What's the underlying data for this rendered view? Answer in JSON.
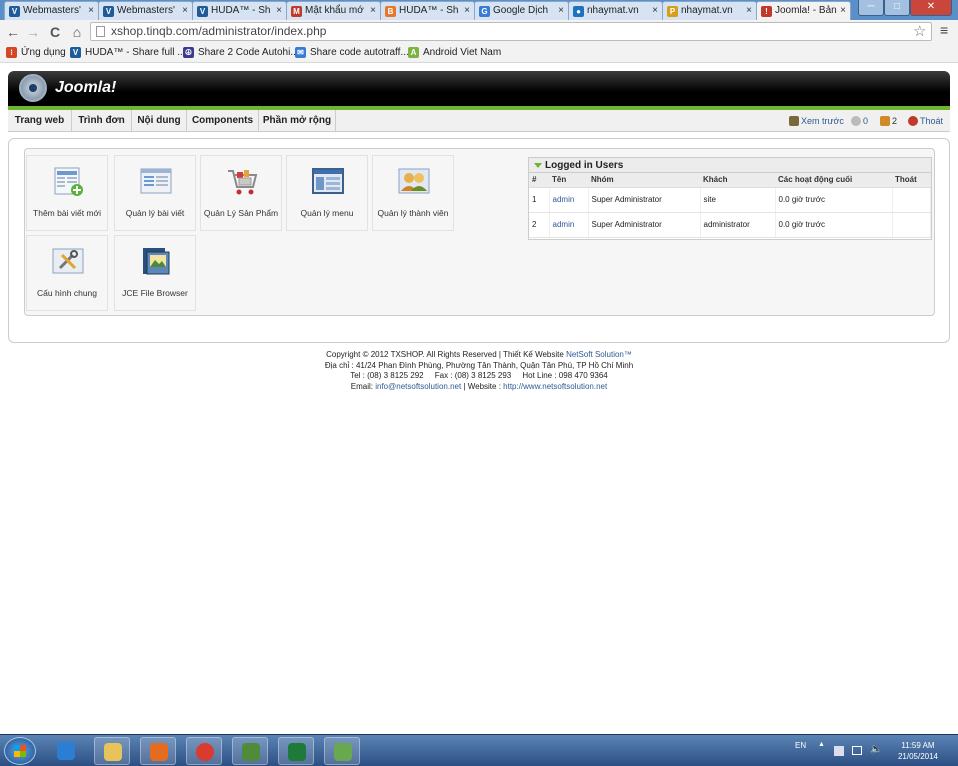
{
  "browser": {
    "tabs": [
      {
        "title": "Webmasters'",
        "icon_color": "#1f5a99",
        "icon_glyph": "V"
      },
      {
        "title": "Webmasters'",
        "icon_color": "#1f5a99",
        "icon_glyph": "V"
      },
      {
        "title": "HUDA™ - Sh",
        "icon_color": "#1f5a99",
        "icon_glyph": "V"
      },
      {
        "title": "Mật khẩu mớ",
        "icon_color": "#c0392b",
        "icon_glyph": "M"
      },
      {
        "title": "HUDA™ - Sh",
        "icon_color": "#e8772e",
        "icon_glyph": "B"
      },
      {
        "title": "Google Dịch",
        "icon_color": "#3a7bd5",
        "icon_glyph": "G"
      },
      {
        "title": "nhaymat.vn",
        "icon_color": "#1e73be",
        "icon_glyph": "●"
      },
      {
        "title": "nhaymat.vn",
        "icon_color": "#d4a017",
        "icon_glyph": "P"
      },
      {
        "title": "Joomla! - Bản",
        "icon_color": "#c0392b",
        "icon_glyph": "!"
      }
    ],
    "tab_close_glyph": "×",
    "address": "xshop.tinqb.com/administrator/index.php",
    "window_controls": {
      "minimize": "─",
      "maximize": "□",
      "close": "✕"
    },
    "nav": {
      "back": "←",
      "forward": "→",
      "reload": "C",
      "home": "⌂"
    },
    "star": "☆",
    "menu": "≡",
    "bookmarks": [
      {
        "label": "Ứng dụng",
        "icon_color": "#d24726",
        "icon_glyph": "⁝"
      },
      {
        "label": "HUDA™ - Share full ...",
        "icon_color": "#1f5a99",
        "icon_glyph": "V"
      },
      {
        "label": "Share 2 Code Autohi...",
        "icon_color": "#3b3b8f",
        "icon_glyph": "☮"
      },
      {
        "label": "Share code autotraff...",
        "icon_color": "#3a7bd5",
        "icon_glyph": "✉"
      },
      {
        "label": "Android Viet Nam",
        "icon_color": "#7cb342",
        "icon_glyph": "A"
      }
    ]
  },
  "joomla": {
    "title": "Joomla!",
    "menu": [
      "Trang web",
      "Trình đơn",
      "Nội dung",
      "Components",
      "Phần mở rộng"
    ],
    "status": {
      "preview": "Xem trước",
      "messages": "0",
      "users": "2",
      "logout": "Thoát"
    },
    "quick_icons": [
      {
        "label": "Thêm bài viết mới",
        "icon": "add-article-icon"
      },
      {
        "label": "Quản lý bài viết",
        "icon": "article-manager-icon"
      },
      {
        "label": "Quản Lý Sản Phẩm",
        "icon": "cart-icon"
      },
      {
        "label": "Quản lý menu",
        "icon": "menu-manager-icon"
      },
      {
        "label": "Quản lý thành viên",
        "icon": "user-manager-icon"
      },
      {
        "label": "Cấu hình chung",
        "icon": "config-icon"
      },
      {
        "label": "JCE File Browser",
        "icon": "file-browser-icon"
      }
    ],
    "logged_in": {
      "title": "Logged in Users",
      "columns": [
        "#",
        "Tên",
        "Nhóm",
        "Khách",
        "Các hoạt động cuối",
        "Thoát"
      ],
      "rows": [
        {
          "num": "1",
          "name": "admin",
          "group": "Super Administrator",
          "client": "site",
          "last": "0.0 giờ trước",
          "logout": ""
        },
        {
          "num": "2",
          "name": "admin",
          "group": "Super Administrator",
          "client": "administrator",
          "last": "0.0 giờ trước",
          "logout": ""
        }
      ]
    },
    "footer": {
      "line1_prefix": "Copyright © 2012 TXSHOP. All Rights Reserved | Thiết Kế Website ",
      "line1_link": "NetSoft Solution™",
      "line2": "Địa chỉ : 41/24 Phan Đình Phùng, Phường Tân Thành, Quận Tân Phú, TP Hồ Chí Minh",
      "line3": "Tel : (08) 3 8125 292     Fax : (08) 3 8125 293     Hot Line : 098 470 9364",
      "line4_prefix": "Email: ",
      "email": "info@netsoftsolution.net",
      "line4_mid": " | Website : ",
      "website": "http://www.netsoftsolution.net"
    }
  },
  "taskbar": {
    "apps": [
      {
        "name": "ie",
        "color": "#2a7fd4",
        "pinned": false
      },
      {
        "name": "explorer",
        "color": "#e8c25a",
        "pinned": true
      },
      {
        "name": "media-player",
        "color": "#e36c1f",
        "pinned": true
      },
      {
        "name": "chrome",
        "color": "#d93b2f",
        "pinned": true
      },
      {
        "name": "network-app",
        "color": "#4f8b3b",
        "pinned": true
      },
      {
        "name": "excel",
        "color": "#1f7a3a",
        "pinned": true
      },
      {
        "name": "tool-app",
        "color": "#6aa84f",
        "pinned": true
      }
    ],
    "language": "EN",
    "time": "11:59 AM",
    "date": "21/05/2014"
  }
}
